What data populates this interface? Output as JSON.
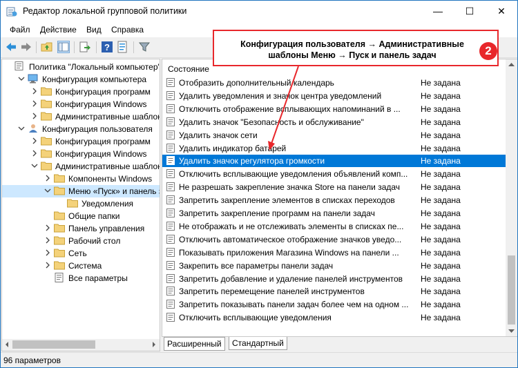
{
  "window": {
    "title": "Редактор локальной групповой политики",
    "minimize": "—",
    "maximize": "☐",
    "close": "✕"
  },
  "menu": [
    "Файл",
    "Действие",
    "Вид",
    "Справка"
  ],
  "tree": [
    {
      "label": "Политика \"Локальный компьютер\"",
      "level": 0,
      "icon": "computer-icon",
      "twisty": "none"
    },
    {
      "label": "Конфигурация компьютера",
      "level": 1,
      "icon": "computer-config-icon",
      "twisty": "expanded"
    },
    {
      "label": "Конфигурация программ",
      "level": 2,
      "icon": "folder-icon",
      "twisty": "collapsed"
    },
    {
      "label": "Конфигурация Windows",
      "level": 2,
      "icon": "folder-icon",
      "twisty": "collapsed"
    },
    {
      "label": "Административные шаблоны",
      "level": 2,
      "icon": "folder-icon",
      "twisty": "collapsed"
    },
    {
      "label": "Конфигурация пользователя",
      "level": 1,
      "icon": "user-config-icon",
      "twisty": "expanded"
    },
    {
      "label": "Конфигурация программ",
      "level": 2,
      "icon": "folder-icon",
      "twisty": "collapsed"
    },
    {
      "label": "Конфигурация Windows",
      "level": 2,
      "icon": "folder-icon",
      "twisty": "collapsed"
    },
    {
      "label": "Административные шаблоны",
      "level": 2,
      "icon": "folder-icon",
      "twisty": "expanded"
    },
    {
      "label": "Компоненты Windows",
      "level": 3,
      "icon": "folder-icon",
      "twisty": "collapsed"
    },
    {
      "label": "Меню «Пуск» и панель задач",
      "level": 3,
      "icon": "folder-icon",
      "twisty": "expanded",
      "selected": true
    },
    {
      "label": "Уведомления",
      "level": 4,
      "icon": "folder-icon",
      "twisty": "none"
    },
    {
      "label": "Общие папки",
      "level": 3,
      "icon": "folder-icon",
      "twisty": "none"
    },
    {
      "label": "Панель управления",
      "level": 3,
      "icon": "folder-icon",
      "twisty": "collapsed"
    },
    {
      "label": "Рабочий стол",
      "level": 3,
      "icon": "folder-icon",
      "twisty": "collapsed"
    },
    {
      "label": "Сеть",
      "level": 3,
      "icon": "folder-icon",
      "twisty": "collapsed"
    },
    {
      "label": "Система",
      "level": 3,
      "icon": "folder-icon",
      "twisty": "collapsed"
    },
    {
      "label": "Все параметры",
      "level": 3,
      "icon": "settings-list-icon",
      "twisty": "none"
    }
  ],
  "list": {
    "column_state_header": "Состояние",
    "rows": [
      {
        "name": "Отобразить дополнительный календарь",
        "state": "Не задана"
      },
      {
        "name": "Удалить уведомления и значок центра уведомлений",
        "state": "Не задана"
      },
      {
        "name": "Отключить отображение всплывающих напоминаний в ...",
        "state": "Не задана"
      },
      {
        "name": "Удалить значок \"Безопасность и обслуживание\"",
        "state": "Не задана"
      },
      {
        "name": "Удалить значок сети",
        "state": "Не задана"
      },
      {
        "name": "Удалить индикатор батарей",
        "state": "Не задана"
      },
      {
        "name": "Удалить значок регулятора громкости",
        "state": "Не задана",
        "selected": true
      },
      {
        "name": "Отключить всплывающие уведомления объявлений комп...",
        "state": "Не задана"
      },
      {
        "name": "Не разрешать закрепление значка Store на панели задач",
        "state": "Не задана"
      },
      {
        "name": "Запретить закрепление элементов в списках переходов",
        "state": "Не задана"
      },
      {
        "name": "Запретить закрепление программ на панели задач",
        "state": "Не задана"
      },
      {
        "name": "Не отображать и не отслеживать элементы в списках пе...",
        "state": "Не задана"
      },
      {
        "name": "Отключить автоматическое отображение значков уведо...",
        "state": "Не задана"
      },
      {
        "name": "Показывать приложения Магазина Windows на панели ...",
        "state": "Не задана"
      },
      {
        "name": "Закрепить все параметры панели задач",
        "state": "Не задана"
      },
      {
        "name": "Запретить добавление и удаление панелей инструментов",
        "state": "Не задана"
      },
      {
        "name": "Запретить перемещение панелей инструментов",
        "state": "Не задана"
      },
      {
        "name": "Запретить показывать панели задач более чем на одном ...",
        "state": "Не задана"
      },
      {
        "name": "Отключить всплывающие уведомления",
        "state": "Не задана"
      }
    ]
  },
  "tabs": [
    "Расширенный",
    "Стандартный"
  ],
  "status": "96 параметров",
  "callout": {
    "text": "Конфигурация пользователя → Административные шаблоны Меню → Пуск и панель задач",
    "number": "2"
  },
  "colors": {
    "accent": "#0078d7",
    "callout_red": "#e8272b",
    "folder_yellow": "#f4d27a",
    "selection_light": "#cde8ff"
  }
}
